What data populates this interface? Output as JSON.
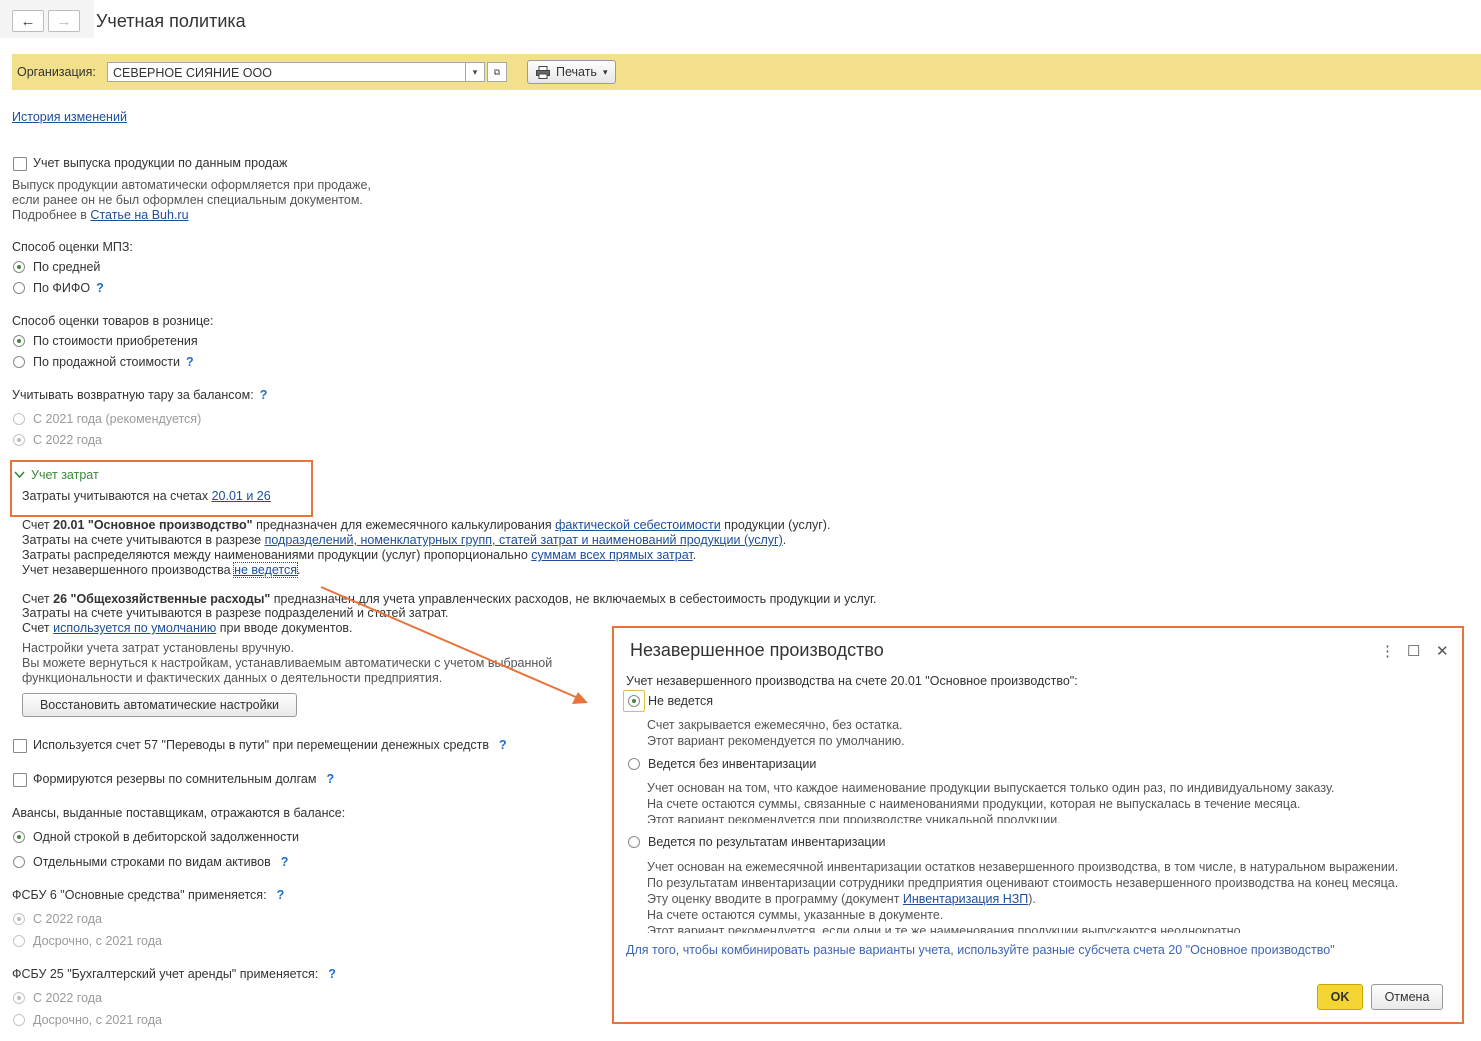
{
  "header": {
    "title": "Учетная политика",
    "back_icon": "←",
    "forward_icon": "→"
  },
  "toolbar": {
    "org_label": "Организация:",
    "org_value": "СЕВЕРНОЕ СИЯНИЕ ООО",
    "print_label": "Печать",
    "print_arrow": "▾",
    "dropdown_arrow": "▾",
    "open_icon": "⧉"
  },
  "history_link": "История изменений",
  "sales_output": {
    "label": "Учет выпуска продукции по данным продаж",
    "desc1": "Выпуск продукции автоматически оформляется при продаже,",
    "desc2": "если ранее он не был оформлен специальным документом.",
    "more_prefix": "Подробнее в ",
    "more_link": "Статье на Buh.ru"
  },
  "mpz": {
    "title": "Способ оценки МПЗ:",
    "opt1": "По средней",
    "opt2": "По ФИФО"
  },
  "retail": {
    "title": "Способ оценки товаров в рознице:",
    "opt1": "По стоимости приобретения",
    "opt2": "По продажной стоимости"
  },
  "tare": {
    "title": "Учитывать возвратную тару за балансом:",
    "opt1": "С 2021 года (рекомендуется)",
    "opt2": "С 2022 года"
  },
  "cost": {
    "title": "Учет затрат",
    "line_prefix": "Затраты учитываются на счетах ",
    "line_link": "20.01 и 26",
    "a1_prefix": "Счет ",
    "a1_bold": "20.01 \"Основное производство\"",
    "a1_mid": " предназначен для ежемесячного калькулирования ",
    "a1_link": "фактической себестоимости",
    "a1_suffix": " продукции (услуг).",
    "a2_prefix": "Затраты на счете учитываются в разрезе ",
    "a2_link": "подразделений, номенклатурных групп, статей затрат и наименований продукции (услуг)",
    "a2_suffix": ".",
    "a3_prefix": "Затраты распределяются между наименованиями продукции (услуг) пропорционально ",
    "a3_link": "суммам всех прямых затрат",
    "a3_suffix": ".",
    "a4_prefix": "Учет незавершенного производства ",
    "a4_link": "не ведется",
    "a4_suffix": ".",
    "b1_prefix": "Счет ",
    "b1_bold": "26 \"Общехозяйственные расходы\"",
    "b1_rest": " предназначен для учета управленческих расходов, не включаемых в себестоимость продукции и услуг.",
    "b2": "Затраты на счете учитываются в разрезе подразделений и статей затрат.",
    "b3_prefix": "Счет ",
    "b3_link": "используется по умолчанию",
    "b3_suffix": " при вводе документов.",
    "n1": "Настройки учета затрат установлены вручную.",
    "n2": "Вы можете вернуться к настройкам, устанавливаемым автоматически с учетом выбранной",
    "n3": "функциональности и фактических данных о деятельности предприятия.",
    "restore_button": "Восстановить автоматические настройки"
  },
  "acc57": {
    "label": "Используется счет 57 \"Переводы в пути\" при перемещении денежных средств"
  },
  "reserves": {
    "label": "Формируются резервы по сомнительным долгам"
  },
  "advances": {
    "title": "Авансы, выданные поставщикам, отражаются в балансе:",
    "opt1": "Одной строкой в дебиторской задолженности",
    "opt2": "Отдельными строками по видам активов"
  },
  "fsbu6": {
    "title": "ФСБУ 6 \"Основные средства\" применяется:",
    "opt1": "С 2022 года",
    "opt2": "Досрочно, с 2021 года"
  },
  "fsbu25": {
    "title": "ФСБУ 25 \"Бухгалтерский учет аренды\" применяется:",
    "opt1": "С 2022 года",
    "opt2": "Досрочно, с 2021 года"
  },
  "help_mark": "?",
  "dialog": {
    "title": "Незавершенное производство",
    "more_icon": "⋮",
    "maximize_icon": "☐",
    "close_icon": "✕",
    "prompt": "Учет незавершенного производства на счете 20.01 \"Основное производство\":",
    "opt1": "Не ведется",
    "opt1_d1": "Счет закрывается ежемесячно, без остатка.",
    "opt1_d2": "Этот вариант рекомендуется по умолчанию.",
    "opt2": "Ведется без инвентаризации",
    "opt2_d1": "Учет основан на том, что каждое наименование продукции выпускается только один раз, по индивидуальному заказу.",
    "opt2_d2": "На счете остаются суммы, связанные с наименованиями продукции, которая не выпускалась в течение месяца.",
    "opt2_d3": "Этот вариант рекомендуется при производстве уникальной продукции.",
    "opt3": "Ведется по результатам инвентаризации",
    "opt3_d1": "Учет основан на ежемесячной инвентаризации остатков незавершенного производства, в том числе, в натуральном выражении.",
    "opt3_d2": "По результатам инвентаризации сотрудники предприятия оценивают стоимость незавершенного производства на конец месяца.",
    "opt3_d3_prefix": "Эту оценку вводите в программу (документ ",
    "opt3_d3_link": "Инвентаризация НЗП",
    "opt3_d3_suffix": ").",
    "opt3_d4": "На счете остаются суммы, указанные в документе.",
    "opt3_d5": "Этот вариант рекомендуется, если одни и те же наименования продукции выпускаются неоднократно.",
    "footer_note": "Для того, чтобы комбинировать разные варианты учета, используйте разные субсчета счета 20 \"Основное производство\"",
    "ok_button": "OK",
    "cancel_button": "Отмена"
  },
  "colors": {
    "accent": "#e8743b",
    "toolbar_bg": "#f2e08a",
    "ok_bg": "#f4d534",
    "link": "#1f4e9a",
    "help": "#1f6fc5"
  }
}
